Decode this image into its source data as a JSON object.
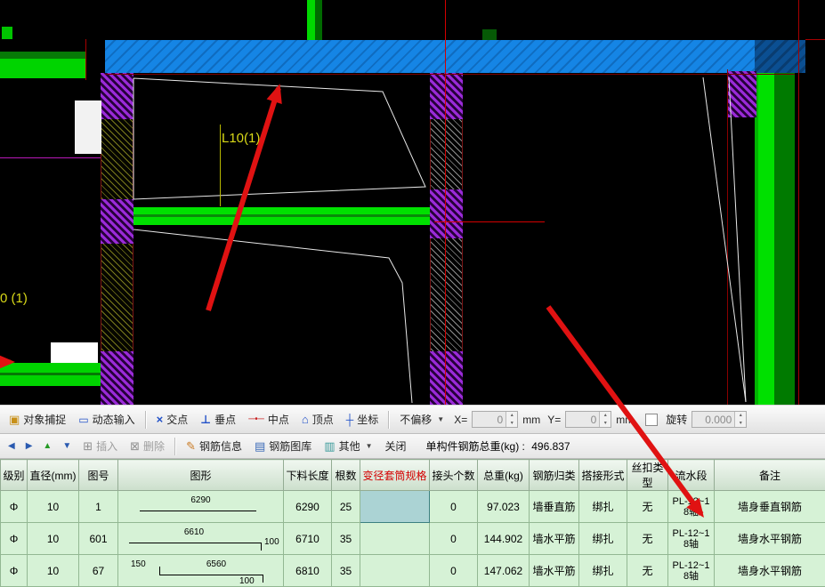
{
  "canvas": {
    "label_l10": "L10(1)",
    "label_partial": "0 (1)"
  },
  "icons": {
    "object_snap": "▣",
    "dynamic_input": "▭",
    "intersection": "×",
    "perpendicular": "⊥",
    "midpoint": "─•─",
    "vertex": "⌂",
    "coordinate": "┼",
    "dropdown": "▼",
    "spin_up": "▴",
    "spin_down": "▾",
    "nav_first": "◀",
    "nav_last": "▶",
    "nav_up": "▲",
    "nav_down": "▼",
    "insert": "⊞",
    "delete": "⊠",
    "pencil": "✎",
    "library": "▤",
    "other": "▥"
  },
  "snapbar": {
    "object_snap": "对象捕捉",
    "dynamic_input": "动态输入",
    "intersection": "交点",
    "perpendicular": "垂点",
    "midpoint": "中点",
    "vertex": "顶点",
    "coordinate": "坐标",
    "offset_mode": "不偏移",
    "x_label": "X=",
    "x_value": "0",
    "y_label": "Y=",
    "y_value": "0",
    "mm": "mm",
    "rotate_label": "旋转",
    "rotate_value": "0.000"
  },
  "editbar": {
    "insert": "插入",
    "delete": "删除",
    "rebar_info": "钢筋信息",
    "rebar_library": "钢筋图库",
    "other": "其他",
    "close": "关闭",
    "total_label": "单构件钢筋总重(kg) : ",
    "total_value": "496.837"
  },
  "table": {
    "headers": [
      "级别",
      "直径(mm)",
      "图号",
      "图形",
      "下料长度",
      "根数",
      "变径套筒规格",
      "接头个数",
      "总重(kg)",
      "钢筋归类",
      "搭接形式",
      "丝扣类型",
      "流水段",
      "备注"
    ],
    "rows": [
      {
        "level": "Φ",
        "diameter": "10",
        "fig_no": "1",
        "shape_left": "",
        "shape_mid": "6290",
        "shape_right": "",
        "length": "6290",
        "count": "25",
        "sleeve": "",
        "joints": "0",
        "weight": "97.023",
        "category": "墙垂直筋",
        "lap": "绑扎",
        "thread": "无",
        "flow": "PL-12~1\n8轴",
        "remark": "墙身垂直钢筋"
      },
      {
        "level": "Φ",
        "diameter": "10",
        "fig_no": "601",
        "shape_left": "",
        "shape_mid": "6610",
        "shape_right": "100",
        "length": "6710",
        "count": "35",
        "sleeve": "",
        "joints": "0",
        "weight": "144.902",
        "category": "墙水平筋",
        "lap": "绑扎",
        "thread": "无",
        "flow": "PL-12~1\n8轴",
        "remark": "墙身水平钢筋"
      },
      {
        "level": "Φ",
        "diameter": "10",
        "fig_no": "67",
        "shape_left": "150",
        "shape_mid": "6560",
        "shape_right": "100",
        "length": "6810",
        "count": "35",
        "sleeve": "",
        "joints": "0",
        "weight": "147.062",
        "category": "墙水平筋",
        "lap": "绑扎",
        "thread": "无",
        "flow": "PL-12~1\n8轴",
        "remark": "墙身水平钢筋"
      }
    ]
  }
}
